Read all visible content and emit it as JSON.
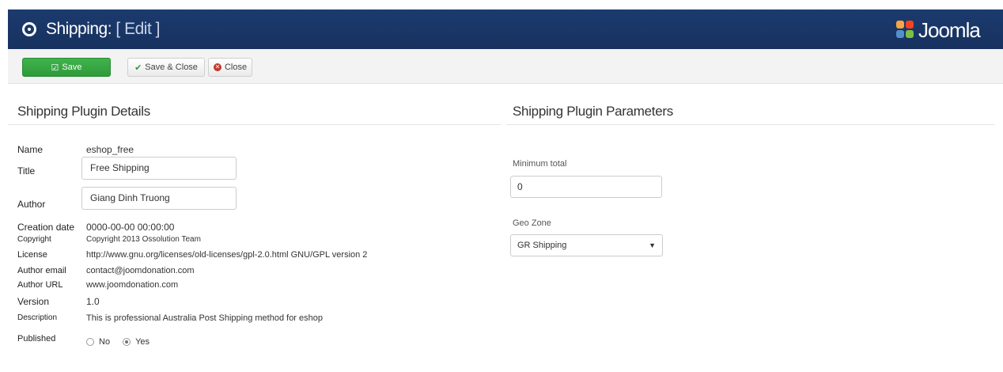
{
  "header": {
    "title": "Shipping:",
    "subtitle": "[ Edit ]",
    "brand": "Joomla"
  },
  "toolbar": {
    "save_label": "Save",
    "save_close_label": "Save & Close",
    "close_label": "Close"
  },
  "details": {
    "heading": "Shipping Plugin Details",
    "fields": {
      "name_label": "Name",
      "name_value": "eshop_free",
      "title_label": "Title",
      "title_value": "Free Shipping",
      "author_label": "Author",
      "author_value": "Giang Dinh Truong",
      "creation_label": "Creation date",
      "creation_value": "0000-00-00 00:00:00",
      "copyright_label": "Copyright",
      "copyright_value": "Copyright 2013 Ossolution Team",
      "license_label": "License",
      "license_value": "http://www.gnu.org/licenses/old-licenses/gpl-2.0.html GNU/GPL version 2",
      "email_label": "Author email",
      "email_value": "contact@joomdonation.com",
      "url_label": "Author URL",
      "url_value": "www.joomdonation.com",
      "version_label": "Version",
      "version_value": "1.0",
      "description_label": "Description",
      "description_value": "This is professional Australia Post Shipping method for eshop",
      "published_label": "Published",
      "published_no": "No",
      "published_yes": "Yes"
    }
  },
  "parameters": {
    "heading": "Shipping Plugin Parameters",
    "min_total_label": "Minimum total",
    "min_total_value": "0",
    "geozone_label": "Geo Zone",
    "geozone_value": "GR Shipping"
  },
  "colors": {
    "header_bg": "#1c3a6e",
    "save_green": "#3fb44b",
    "close_red": "#c0392b"
  }
}
